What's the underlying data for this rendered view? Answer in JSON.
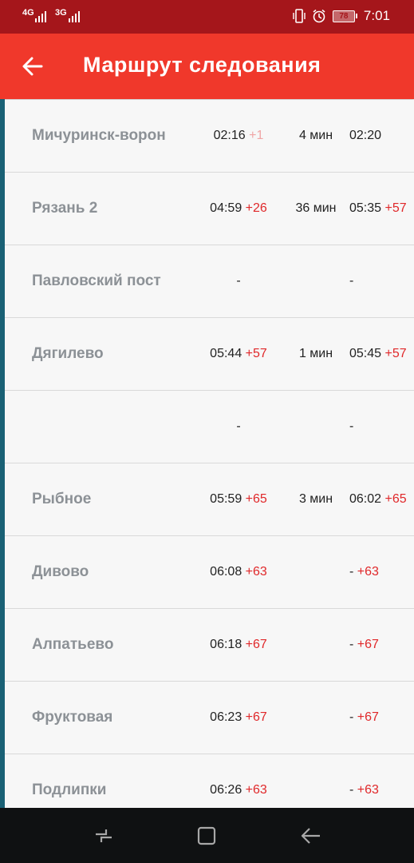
{
  "status_bar": {
    "sim1_label": "4G",
    "sim2_label": "3G",
    "battery": "78",
    "time": "7:01"
  },
  "app_bar": {
    "title": "Маршрут следования"
  },
  "colors": {
    "status_bar": "#a5161b",
    "app_bar": "#f0382b",
    "route_line": "#1a6175",
    "delay": "#e0282a"
  },
  "stops": [
    {
      "name": "Мичуринск-ворон",
      "arrival": "02:16",
      "arrival_delay": "+1",
      "stop": "4 мин",
      "departure": "02:20",
      "departure_delay": ""
    },
    {
      "name": "Рязань 2",
      "arrival": "04:59",
      "arrival_delay": "+26",
      "stop": "36 мин",
      "departure": "05:35",
      "departure_delay": "+57"
    },
    {
      "name": "Павловский пост",
      "arrival": "-",
      "arrival_delay": "",
      "stop": "",
      "departure": "-",
      "departure_delay": ""
    },
    {
      "name": "Дягилево",
      "arrival": "05:44",
      "arrival_delay": "+57",
      "stop": "1 мин",
      "departure": "05:45",
      "departure_delay": "+57"
    },
    {
      "name": "",
      "arrival": "-",
      "arrival_delay": "",
      "stop": "",
      "departure": "-",
      "departure_delay": ""
    },
    {
      "name": "Рыбное",
      "arrival": "05:59",
      "arrival_delay": "+65",
      "stop": "3 мин",
      "departure": "06:02",
      "departure_delay": "+65"
    },
    {
      "name": "Дивово",
      "arrival": "06:08",
      "arrival_delay": "+63",
      "stop": "",
      "departure": "-",
      "departure_delay": "+63"
    },
    {
      "name": "Алпатьево",
      "arrival": "06:18",
      "arrival_delay": "+67",
      "stop": "",
      "departure": "-",
      "departure_delay": "+67"
    },
    {
      "name": "Фруктовая",
      "arrival": "06:23",
      "arrival_delay": "+67",
      "stop": "",
      "departure": "-",
      "departure_delay": "+67"
    },
    {
      "name": "Подлипки",
      "arrival": "06:26",
      "arrival_delay": "+63",
      "stop": "",
      "departure": "-",
      "departure_delay": "+63"
    }
  ],
  "nav_bar": {
    "icons": [
      "recent-apps-icon",
      "home-icon",
      "back-icon"
    ]
  }
}
